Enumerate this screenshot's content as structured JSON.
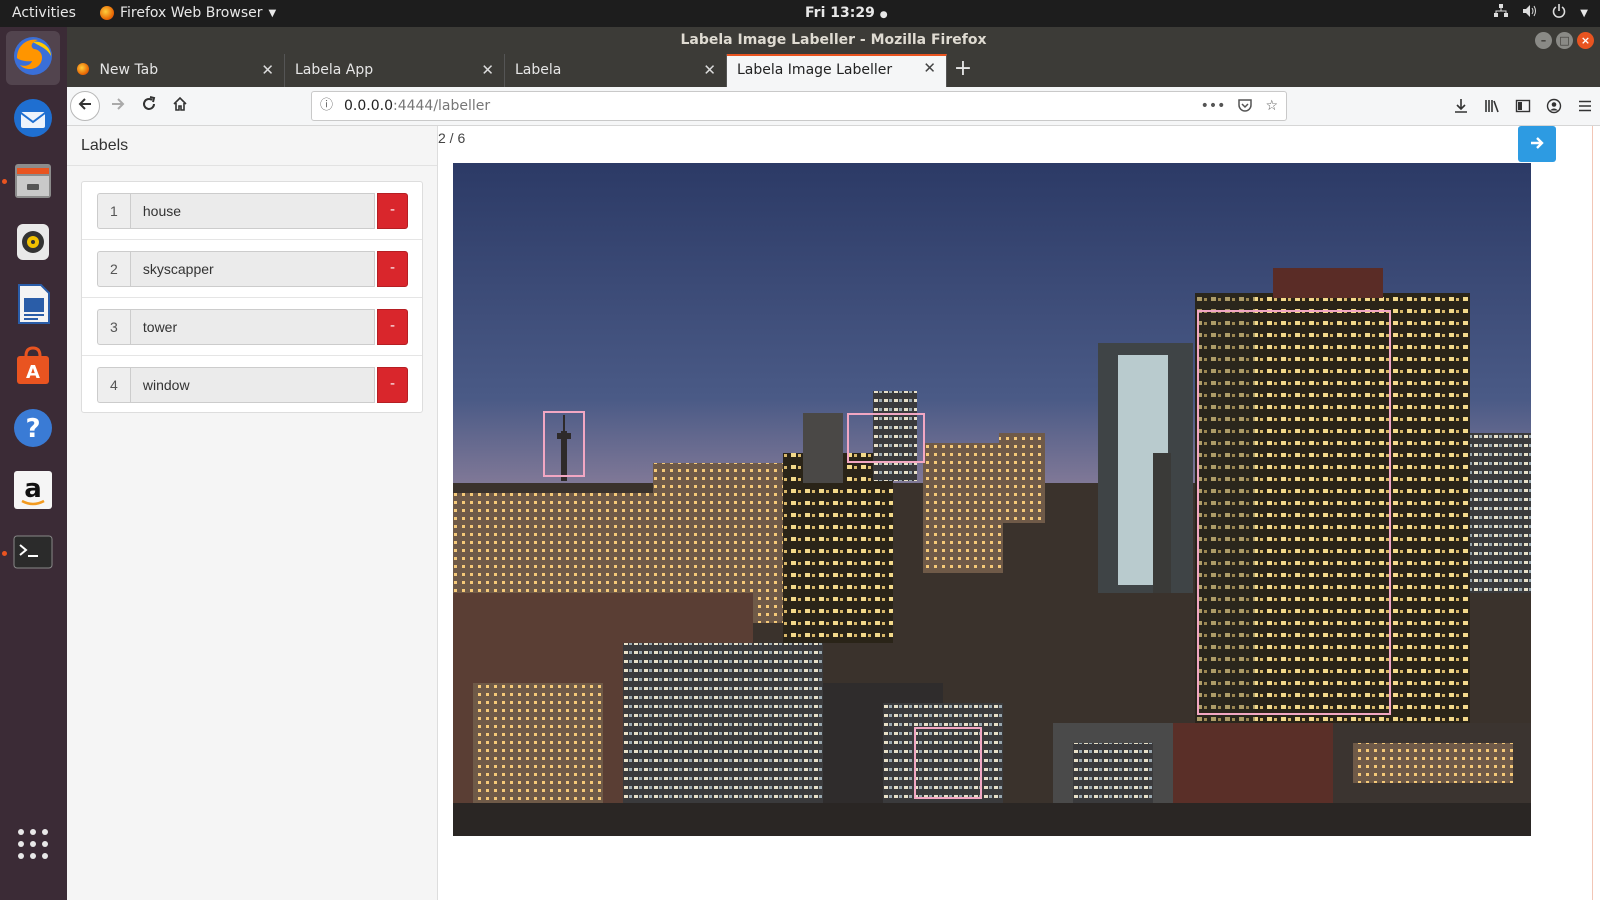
{
  "system": {
    "activities": "Activities",
    "app_menu": "Firefox Web Browser",
    "clock": "Fri 13:29"
  },
  "window": {
    "title": "Labela Image Labeller - Mozilla Firefox"
  },
  "tabs": [
    {
      "label": "New Tab"
    },
    {
      "label": "Labela App"
    },
    {
      "label": "Labela"
    },
    {
      "label": "Labela Image Labeller"
    }
  ],
  "url": {
    "host": "0.0.0.0",
    "path": ":4444/labeller"
  },
  "page": {
    "sidebar_title": "Labels",
    "counter": "2 / 6",
    "delete_label": "-",
    "labels": [
      {
        "num": "1",
        "name": "house"
      },
      {
        "num": "2",
        "name": "skyscapper"
      },
      {
        "num": "3",
        "name": "tower"
      },
      {
        "num": "4",
        "name": "window"
      }
    ]
  },
  "colors": {
    "accent": "#e95420",
    "delete": "#d9262c",
    "next_button": "#2d9be2",
    "box_stroke": "#f2a7c3"
  },
  "icons": [
    "firefox-icon",
    "thunderbird-icon",
    "files-icon",
    "rhythmbox-icon",
    "writer-icon",
    "software-icon",
    "help-icon",
    "amazon-icon",
    "terminal-icon",
    "apps-grid-icon"
  ]
}
